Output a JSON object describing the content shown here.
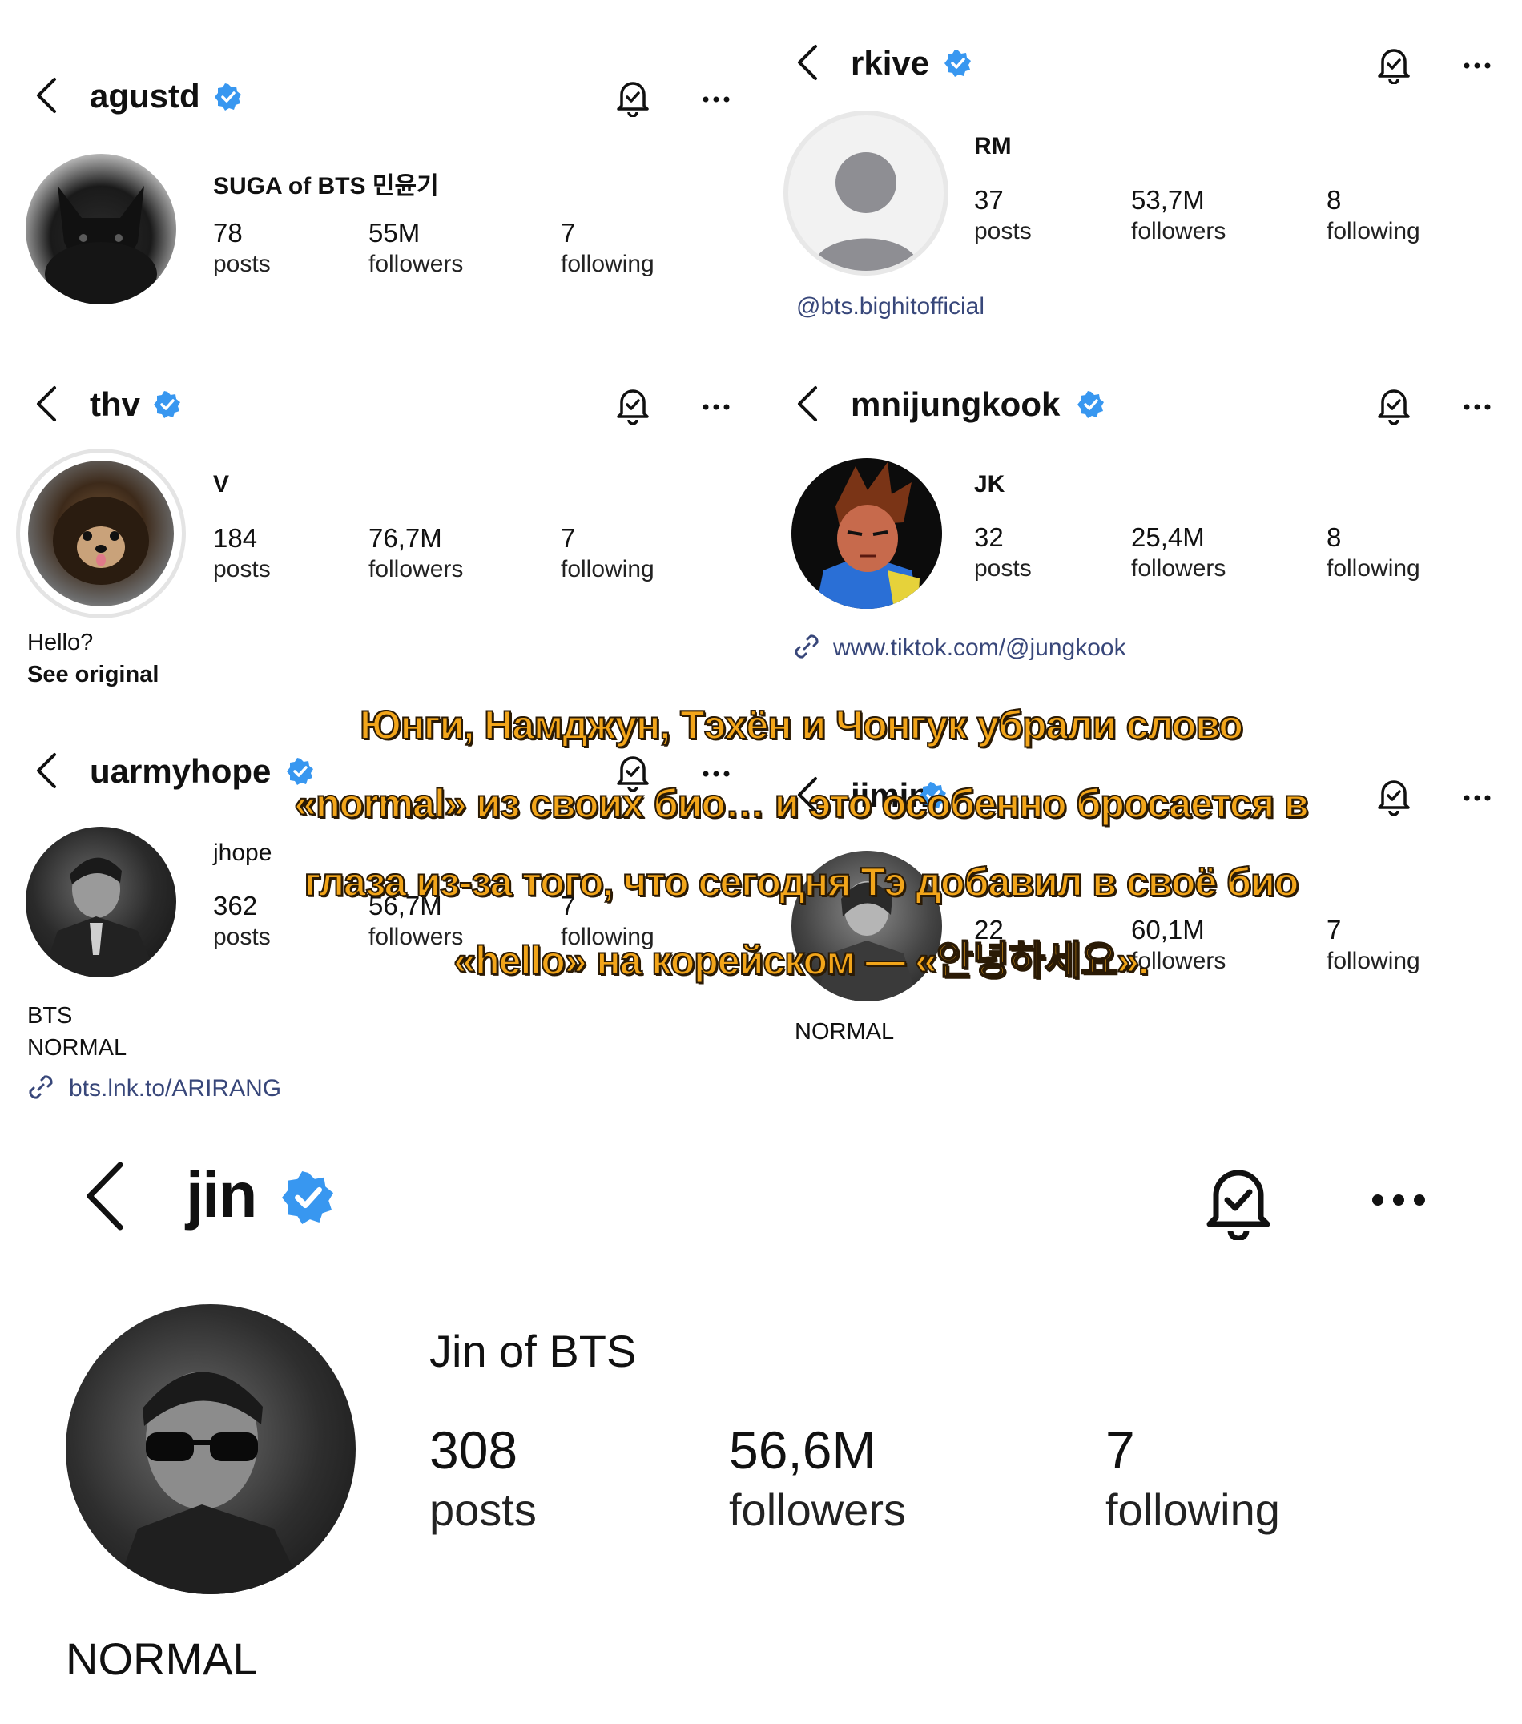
{
  "colors": {
    "verified_blue": "#3897f0",
    "link_color": "#38477a",
    "caption_fill": "#f2a51a",
    "caption_outline": "#2a1a05"
  },
  "stat_labels": {
    "posts": "posts",
    "followers": "followers",
    "following": "following"
  },
  "profiles": [
    {
      "username": "agustd",
      "name": "SUGA of BTS 민윤기",
      "posts": "78",
      "followers": "55M",
      "following": "7",
      "avatar": "black-cat-photo"
    },
    {
      "username": "rkive",
      "name": "RM",
      "posts": "37",
      "followers": "53,7M",
      "following": "8",
      "avatar": "default-avatar",
      "mention": "@bts.bighitofficial"
    },
    {
      "username": "thv",
      "name": "V",
      "posts": "184",
      "followers": "76,7M",
      "following": "7",
      "avatar": "dog-photo",
      "bio": "Hello?",
      "see_original": "See original"
    },
    {
      "username": "mnijungkook",
      "name": "JK",
      "posts": "32",
      "followers": "25,4M",
      "following": "8",
      "avatar": "cartoon-character",
      "link": "www.tiktok.com/@jungkook"
    },
    {
      "username": "uarmyhope",
      "name": "jhope",
      "posts": "362",
      "followers": "56,7M",
      "following": "7",
      "avatar": "man-photo-bw",
      "bio_line1": "BTS",
      "bio_line2": "NORMAL",
      "link": "bts.lnk.to/ARIRANG"
    },
    {
      "username": "jimin",
      "posts": "22",
      "followers": "60,1M",
      "following": "7",
      "avatar": "man-photo-bw",
      "bio": "NORMAL"
    },
    {
      "username": "jin",
      "name": "Jin of BTS",
      "posts": "308",
      "followers": "56,6M",
      "following": "7",
      "avatar": "man-sunglasses-bw",
      "bio": "NORMAL"
    }
  ],
  "caption_lines": [
    "Юнги, Намджун, Тэхён и Чонгук убрали слово",
    "«normal» из своих био… и это особенно бросается в",
    "глаза из-за того, что сегодня Тэ добавил в своё био",
    "«hello» на корейском — «안녕하세요»."
  ]
}
